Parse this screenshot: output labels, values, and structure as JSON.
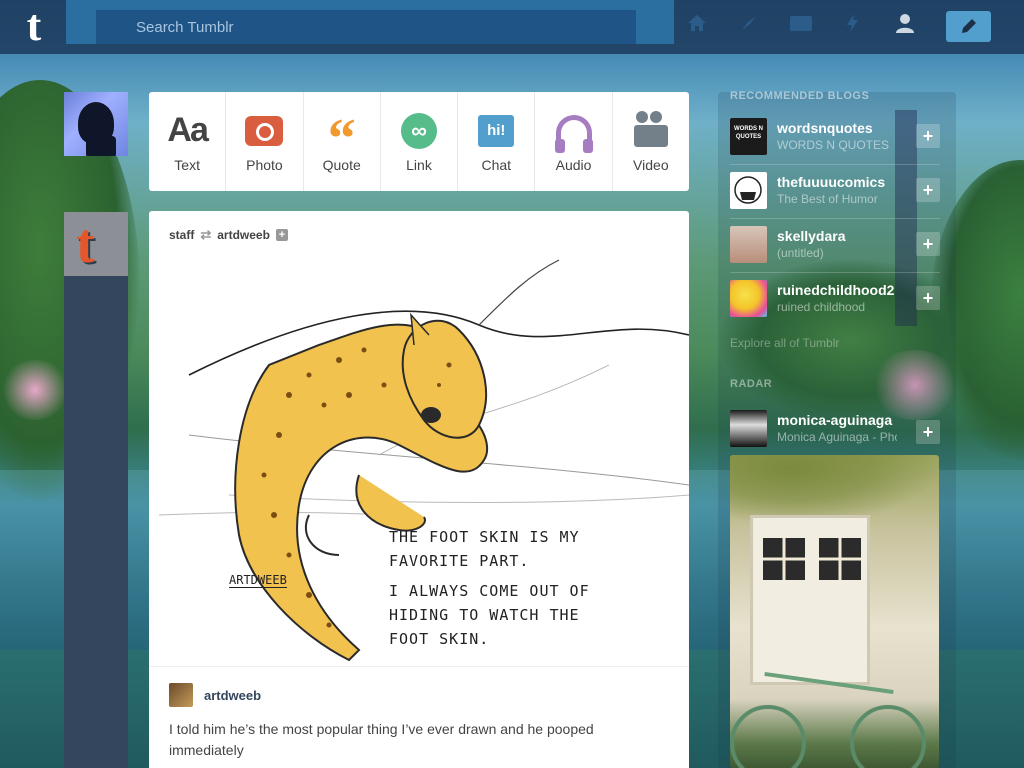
{
  "header": {
    "logo": "t",
    "search_placeholder": "Search Tumblr",
    "nav_icons": [
      "home-icon",
      "compass-icon",
      "inbox-icon",
      "lightning-icon",
      "account-icon"
    ],
    "compose_icon": "pencil-icon"
  },
  "composer": {
    "types": [
      {
        "label": "Text",
        "glyph": "Aa",
        "color": "#444444"
      },
      {
        "label": "Photo",
        "color": "#d95e40"
      },
      {
        "label": "Quote",
        "glyph": "“",
        "color": "#f2992e"
      },
      {
        "label": "Link",
        "glyph": "∞",
        "color": "#56bc8a"
      },
      {
        "label": "Chat",
        "glyph": "hi!",
        "color": "#529ecc"
      },
      {
        "label": "Audio",
        "color": "#a77dc2"
      },
      {
        "label": "Video",
        "color": "#748089"
      }
    ]
  },
  "post": {
    "reblogger": "staff",
    "author": "artdweeb",
    "artwork_text": [
      "THE FOOT SKIN IS MY",
      "FAVORITE PART.",
      "I ALWAYS COME OUT OF",
      "HIDING TO WATCH THE",
      "FOOT SKIN."
    ],
    "signature": "ARTDWEEB",
    "caption_user": "artdweeb",
    "caption_text": "I told him he’s the most popular thing I’ve ever drawn and he pooped immediately"
  },
  "sidebar": {
    "recommended_title": "RECOMMENDED BLOGS",
    "blogs": [
      {
        "name": "wordsnquotes",
        "subtitle": "WORDS N QUOTES",
        "avatar_text": "WORDS N QUOTES"
      },
      {
        "name": "thefuuuucomics",
        "subtitle": "The Best of Humor",
        "avatar_text": ""
      },
      {
        "name": "skellydara",
        "subtitle": "(untitled)",
        "avatar_text": ""
      },
      {
        "name": "ruinedchildhood2",
        "subtitle": "ruined childhood",
        "avatar_text": ""
      }
    ],
    "see_more": "Explore all of Tumblr",
    "radar_title": "RADAR",
    "radar": {
      "name": "monica-aguinaga",
      "subtitle": "Monica Aguinaga - Photography"
    }
  },
  "colors": {
    "header_bg": "#1c3a5c",
    "compose_button": "#529ecc",
    "left_column": "#34465d"
  }
}
